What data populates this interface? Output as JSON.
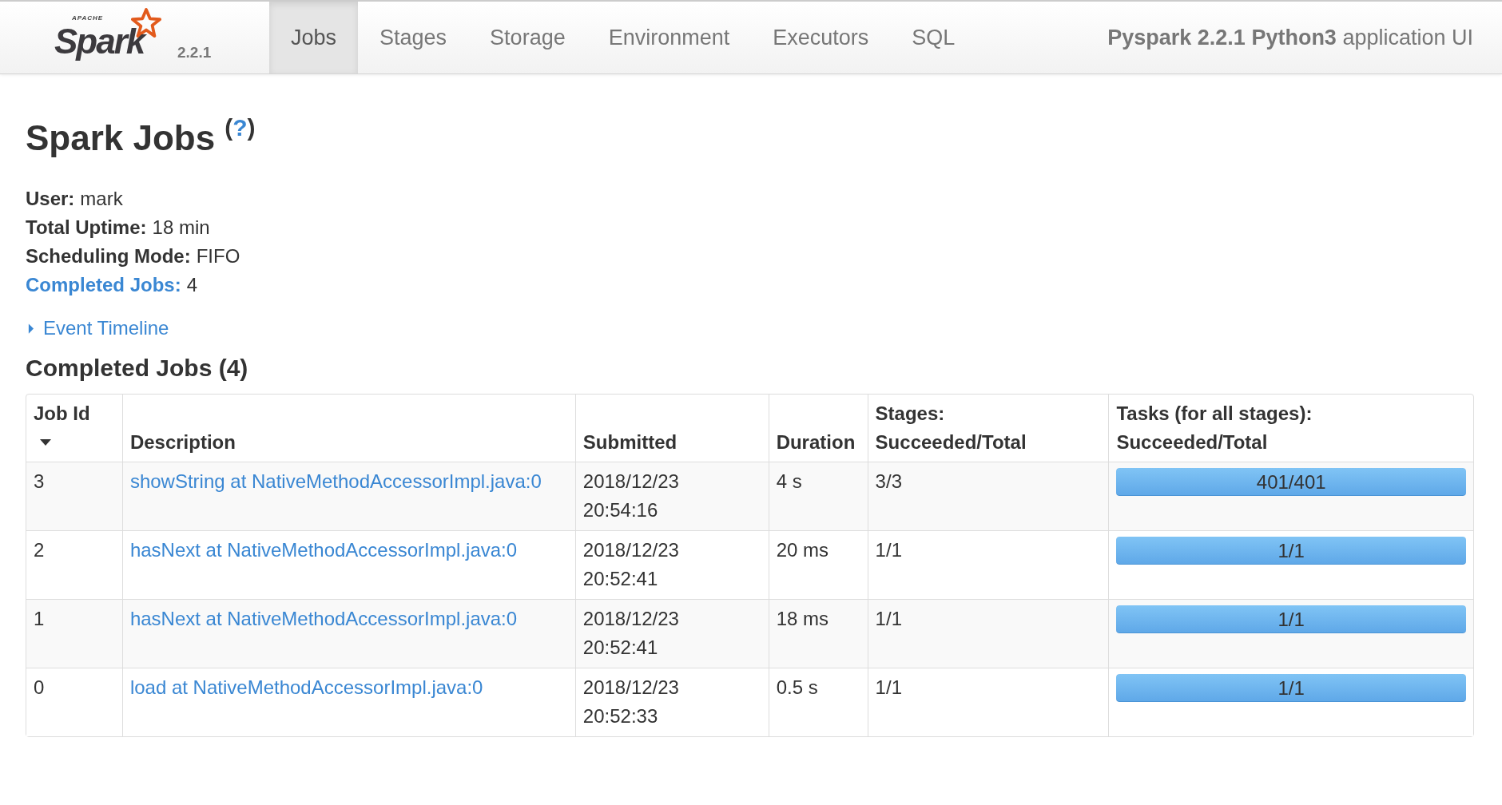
{
  "navbar": {
    "logo": {
      "small": "APACHE",
      "name": "Spark",
      "version": "2.2.1"
    },
    "tabs": [
      {
        "label": "Jobs",
        "selected": true
      },
      {
        "label": "Stages",
        "selected": false
      },
      {
        "label": "Storage",
        "selected": false
      },
      {
        "label": "Environment",
        "selected": false
      },
      {
        "label": "Executors",
        "selected": false
      },
      {
        "label": "SQL",
        "selected": false
      }
    ],
    "app_title": {
      "bold": "Pyspark 2.2.1 Python3",
      "rest": "application UI"
    }
  },
  "page": {
    "title": "Spark Jobs",
    "help": {
      "open": "(",
      "label": "?",
      "close": ")"
    },
    "summary": [
      {
        "kind": "text",
        "label": "User:",
        "value": "mark"
      },
      {
        "kind": "text",
        "label": "Total Uptime:",
        "value": "18 min"
      },
      {
        "kind": "text",
        "label": "Scheduling Mode:",
        "value": "FIFO"
      },
      {
        "kind": "link",
        "label": "Completed Jobs:",
        "value": "4"
      }
    ],
    "event_timeline": {
      "label": "Event Timeline",
      "expanded": false
    },
    "section_title": "Completed Jobs (4)"
  },
  "table": {
    "columns": [
      {
        "lines": [
          "Job Id"
        ],
        "sorted_descending": true
      },
      {
        "lines": [
          "Description"
        ]
      },
      {
        "lines": [
          "Submitted"
        ]
      },
      {
        "lines": [
          "Duration"
        ]
      },
      {
        "lines": [
          "Stages:",
          "Succeeded/Total"
        ]
      },
      {
        "lines": [
          "Tasks (for all stages):",
          "Succeeded/Total"
        ]
      }
    ],
    "rows": [
      {
        "job_id": "3",
        "description": "showString at NativeMethodAccessorImpl.java:0",
        "submitted": [
          "2018/12/23",
          "20:54:16"
        ],
        "duration": "4 s",
        "stages": "3/3",
        "tasks": {
          "label": "401/401",
          "level": 1
        }
      },
      {
        "job_id": "2",
        "description": "hasNext at NativeMethodAccessorImpl.java:0",
        "submitted": [
          "2018/12/23",
          "20:52:41"
        ],
        "duration": "20 ms",
        "stages": "1/1",
        "tasks": {
          "label": "1/1",
          "level": 1
        }
      },
      {
        "job_id": "1",
        "description": "hasNext at NativeMethodAccessorImpl.java:0",
        "submitted": [
          "2018/12/23",
          "20:52:41"
        ],
        "duration": "18 ms",
        "stages": "1/1",
        "tasks": {
          "label": "1/1",
          "level": 1
        }
      },
      {
        "job_id": "0",
        "description": "load at NativeMethodAccessorImpl.java:0",
        "submitted": [
          "2018/12/23",
          "20:52:33"
        ],
        "duration": "0.5 s",
        "stages": "1/1",
        "tasks": {
          "label": "1/1",
          "level": 1
        }
      }
    ]
  }
}
